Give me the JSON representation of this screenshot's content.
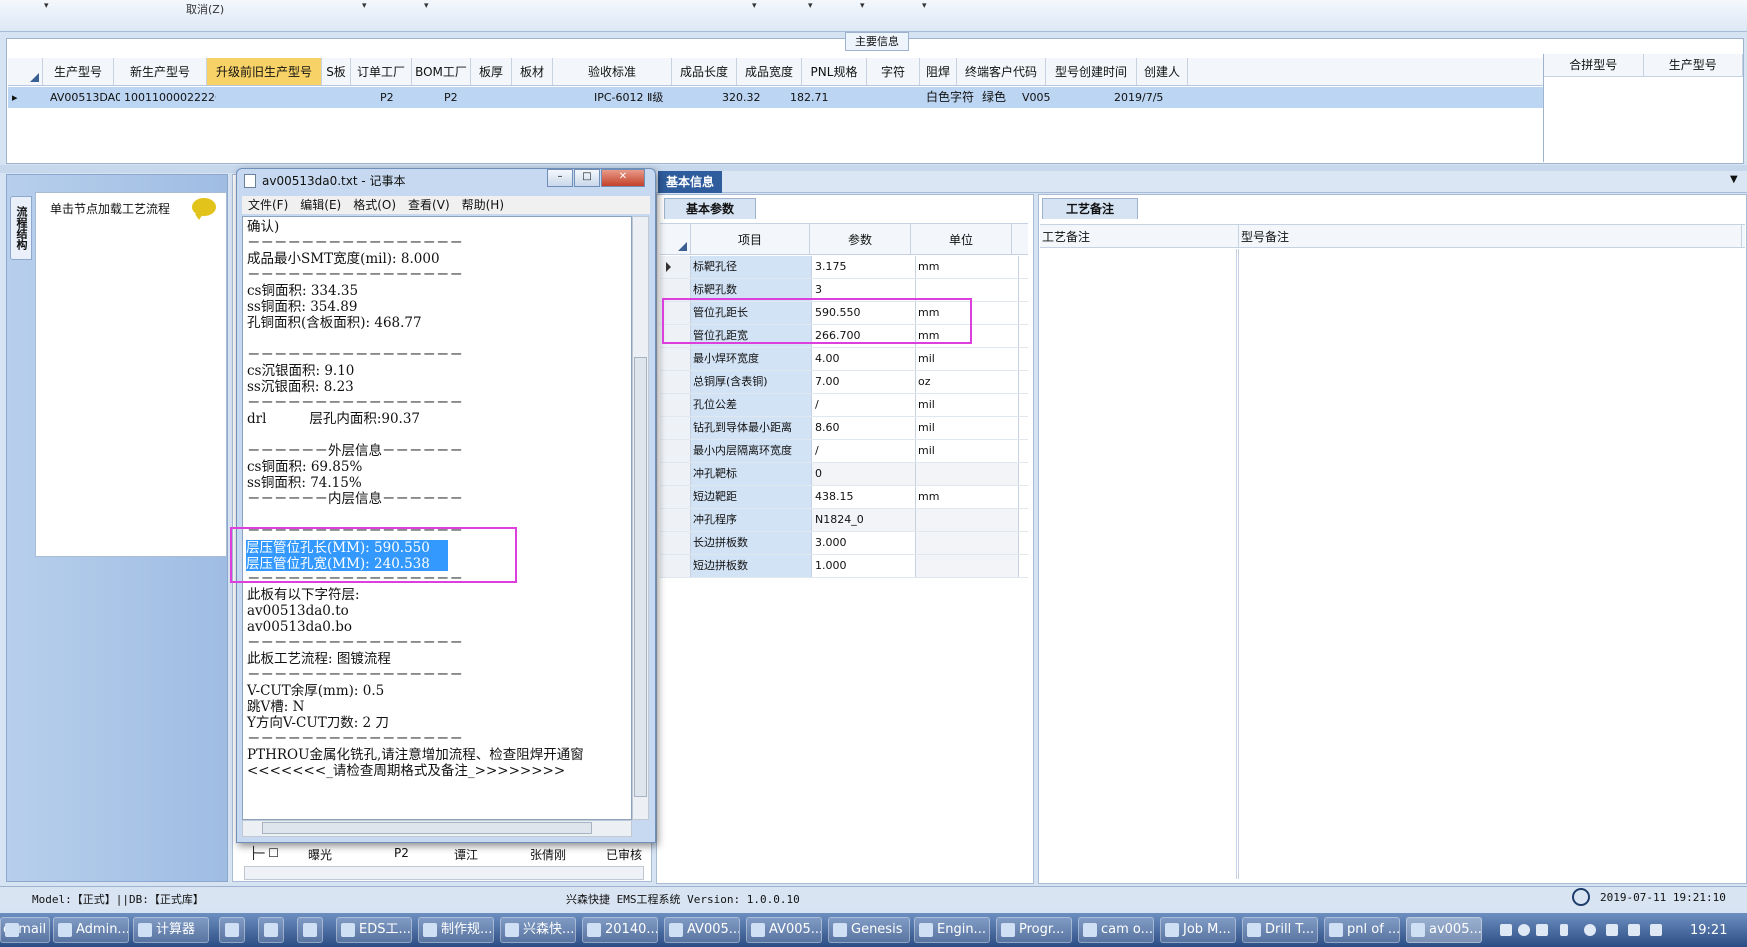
{
  "toolbar": {
    "cancel_label": "取消(Z)"
  },
  "main_info": {
    "title": "主要信息",
    "columns": [
      "生产型号",
      "新生产型号",
      "升级前旧生产型号",
      "S板",
      "订单工厂",
      "BOM工厂",
      "板厚",
      "板材",
      "验收标准",
      "成品长度",
      "成品宽度",
      "PNL规格",
      "字符",
      "阻焊",
      "终端客户代码",
      "型号创建时间",
      "创建人"
    ],
    "row": [
      "AV00513DA0",
      "10011000022226",
      "",
      "",
      "P2",
      "P2",
      "",
      "",
      "IPC-6012 Ⅱ级",
      "320.32",
      "182.71",
      "",
      "白色字符",
      "绿色",
      "V005",
      "2019/7/5",
      ""
    ],
    "merge_columns": [
      "合拼型号",
      "生产型号"
    ]
  },
  "left_panel": {
    "vertical_tab": "流程结构",
    "hint": "单击节点加载工艺流程"
  },
  "list_row": [
    "曝光",
    "P2",
    "谭江",
    "张倩刚",
    "已审核"
  ],
  "basic_info": {
    "tab": "基本信息",
    "param_tab": "基本参数",
    "columns": [
      "项目",
      "参数",
      "单位"
    ],
    "rows": [
      {
        "name": "标靶孔径",
        "value": "3.175",
        "unit": "mm"
      },
      {
        "name": "标靶孔数",
        "value": "3",
        "unit": ""
      },
      {
        "name": "管位孔距长",
        "value": "590.550",
        "unit": "mm"
      },
      {
        "name": "管位孔距宽",
        "value": "266.700",
        "unit": "mm"
      },
      {
        "name": "最小焊环宽度",
        "value": "4.00",
        "unit": "mil"
      },
      {
        "name": "总铜厚(含表铜)",
        "value": "7.00",
        "unit": "oz"
      },
      {
        "name": "孔位公差",
        "value": "/",
        "unit": "mil"
      },
      {
        "name": "钻孔到导体最小距离",
        "value": "8.60",
        "unit": "mil"
      },
      {
        "name": "最小内层隔离环宽度",
        "value": "/",
        "unit": "mil"
      },
      {
        "name": "冲孔靶标",
        "value": "0",
        "unit": ""
      },
      {
        "name": "短边靶距",
        "value": "438.15",
        "unit": "mm"
      },
      {
        "name": "冲孔程序",
        "value": "N1824_0",
        "unit": ""
      },
      {
        "name": "长边拼板数",
        "value": "3.000",
        "unit": ""
      },
      {
        "name": "短边拼板数",
        "value": "1.000",
        "unit": ""
      }
    ]
  },
  "notes": {
    "tab": "工艺备注",
    "col1": "工艺备注",
    "col2": "型号备注"
  },
  "notepad": {
    "title": "av00513da0.txt - 记事本",
    "menu": [
      "文件(F)",
      "编辑(E)",
      "格式(O)",
      "查看(V)",
      "帮助(H)"
    ],
    "text": "确认)\n－－－－－－－－－－－－－－－－\n成品最小SMT宽度(mil): 8.000\n－－－－－－－－－－－－－－－－\ncs铜面积: 334.35\nss铜面积: 354.89\n孔铜面积(含板面积): 468.77\n\n－－－－－－－－－－－－－－－－\ncs沉银面积: 9.10\nss沉银面积: 8.23\n－－－－－－－－－－－－－－－－\ndrl          层孔内面积:90.37\n\n－－－－－－外层信息－－－－－－\ncs铜面积: 69.85%\nss铜面积: 74.15%\n－－－－－－内层信息－－－－－－\n\n－－－－－－－－－－－－－－－－\n\n\n－－－－－－－－－－－－－－－－\n此板有以下字符层:\nav00513da0.to\nav00513da0.bo\n－－－－－－－－－－－－－－－－\n此板工艺流程: 图镀流程\n－－－－－－－－－－－－－－－－\nV-CUT余厚(mm): 0.5\n跳V槽: N\nY方向V-CUT刀数: 2 刀\n－－－－－－－－－－－－－－－－\nPTHROU金属化铣孔,请注意增加流程、检查阻焊开通窗\n<<<<<<<_请检查周期格式及备注_>>>>>>>>",
    "highlight": "层压管位孔长(MM): 590.550\n层压管位孔宽(MM): 240.538"
  },
  "status": {
    "left": "Model:【正式】||DB:【正式库】",
    "mid": "兴森快捷 EMS工程系统 Version: 1.0.0.10",
    "right": "2019-07-11 19:21:10"
  },
  "taskbar": {
    "items": [
      "oxmail",
      "Admin...",
      "计算器",
      "",
      "",
      "",
      "EDS工...",
      "制作规...",
      "兴森快...",
      "20140...",
      "AV005...",
      "AV005...",
      "Genesis",
      "Engin...",
      "Progr...",
      "cam o...",
      "Job M...",
      "Drill T...",
      "pnl of ...",
      "av005..."
    ],
    "time": "19:21"
  },
  "colors": {
    "highlight_col": "#f7d266",
    "annotation": "#dd3fdc",
    "selection": "#3399ff"
  }
}
